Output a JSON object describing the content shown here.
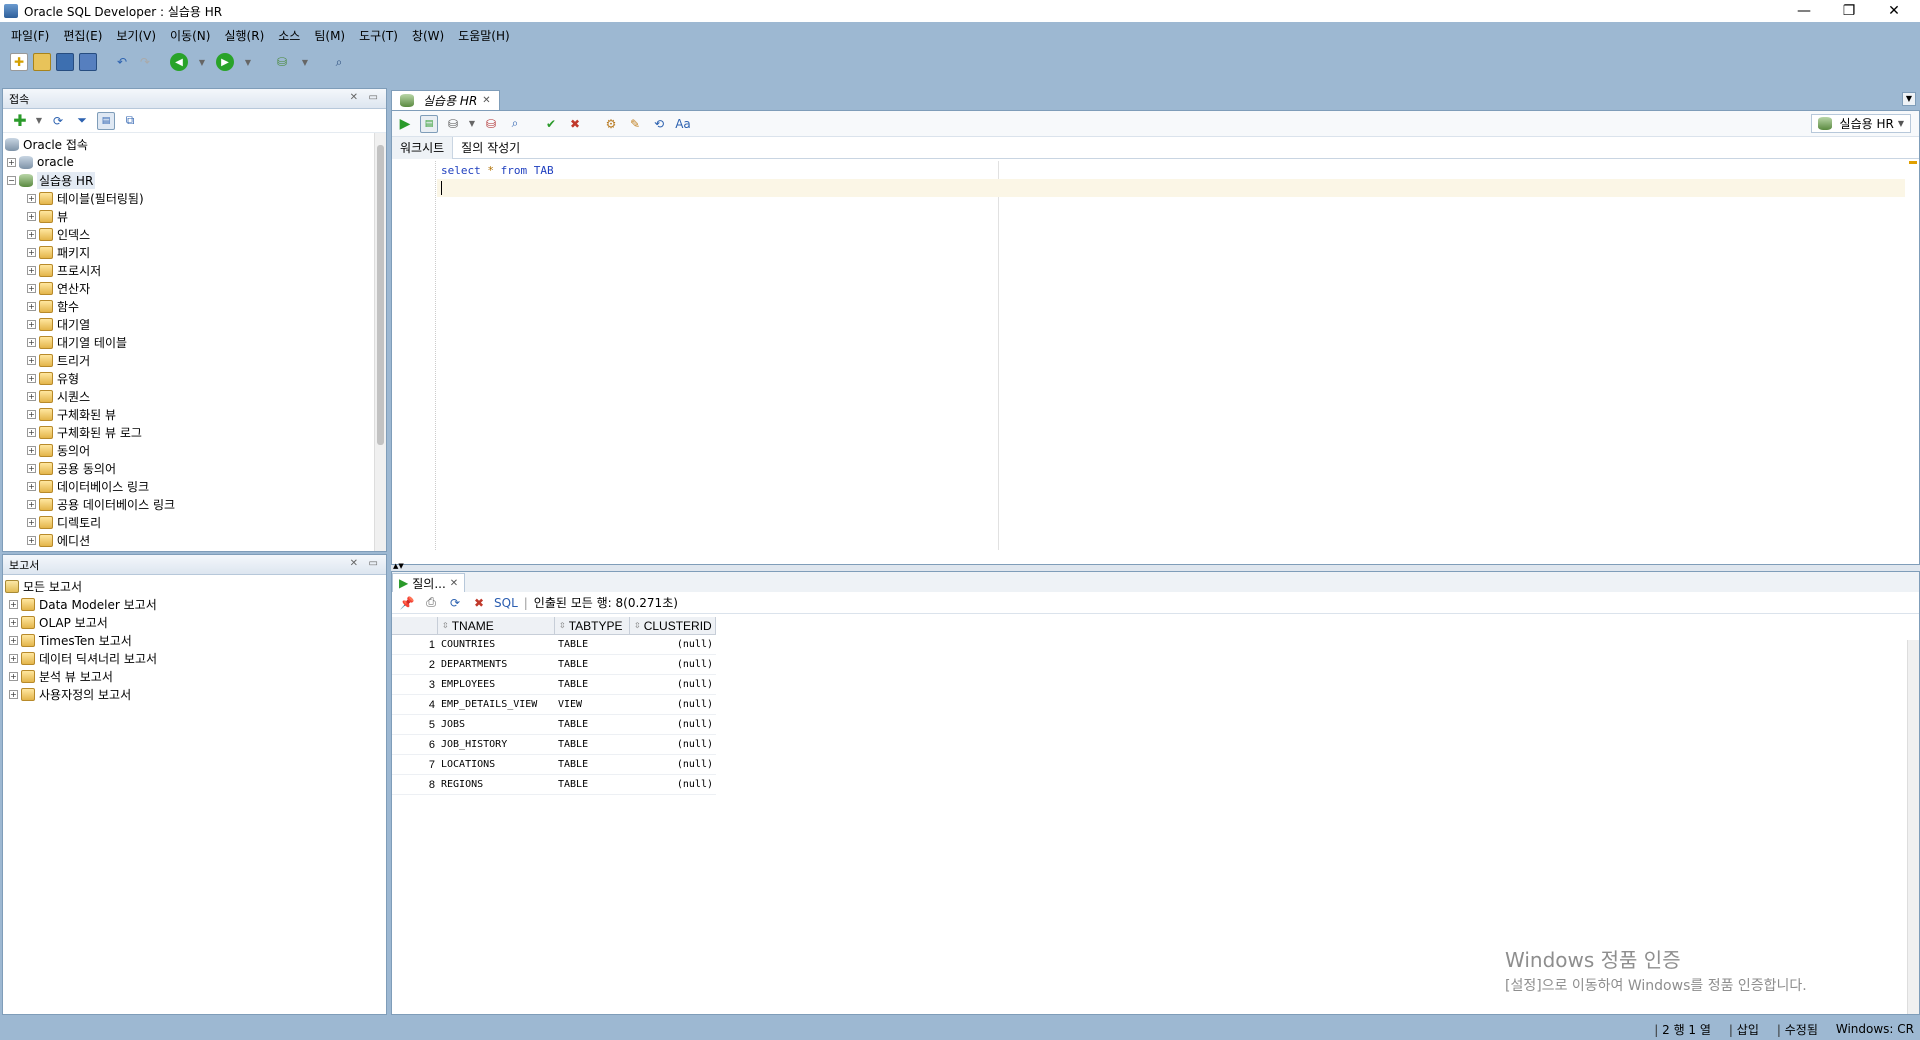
{
  "window": {
    "title": "Oracle SQL Developer : 실습용 HR",
    "controls": {
      "minimize": "—",
      "restore": "❐",
      "close": "✕"
    }
  },
  "menu": [
    "파일(F)",
    "편집(E)",
    "보기(V)",
    "이동(N)",
    "실행(R)",
    "소스",
    "팀(M)",
    "도구(T)",
    "창(W)",
    "도움말(H)"
  ],
  "connections_panel": {
    "title": "접속",
    "tree": {
      "root": "Oracle 접속",
      "conn_oracle": "oracle",
      "conn_hr": "실습용 HR",
      "children": [
        "테이블(필터링됨)",
        "뷰",
        "인덱스",
        "패키지",
        "프로시저",
        "연산자",
        "함수",
        "대기열",
        "대기열 테이블",
        "트리거",
        "유형",
        "시퀀스",
        "구체화된 뷰",
        "구체화된 뷰 로그",
        "동의어",
        "공용 동의어",
        "데이터베이스 링크",
        "공용 데이터베이스 링크",
        "디렉토리",
        "에디션"
      ]
    }
  },
  "reports_panel": {
    "title": "보고서",
    "root": "모든 보고서",
    "items": [
      "Data Modeler 보고서",
      "OLAP 보고서",
      "TimesTen 보고서",
      "데이터 딕셔너리 보고서",
      "분석 뷰 보고서",
      "사용자정의 보고서"
    ]
  },
  "editor": {
    "tab_label": "실습용 HR",
    "subtabs": [
      "워크시트",
      "질의 작성기"
    ],
    "connection_select": "실습용 HR",
    "code": {
      "kw1": "select",
      "star": "*",
      "kw2": "from",
      "table": "TAB"
    }
  },
  "result": {
    "tab_label": "질의...",
    "sql_link": "SQL",
    "status": "인출된 모든 행: 8(0.271초)",
    "columns": [
      "TNAME",
      "TABTYPE",
      "CLUSTERID"
    ],
    "rows": [
      {
        "n": "1",
        "tname": "COUNTRIES",
        "tabtype": "TABLE",
        "clusterid": "(null)"
      },
      {
        "n": "2",
        "tname": "DEPARTMENTS",
        "tabtype": "TABLE",
        "clusterid": "(null)"
      },
      {
        "n": "3",
        "tname": "EMPLOYEES",
        "tabtype": "TABLE",
        "clusterid": "(null)"
      },
      {
        "n": "4",
        "tname": "EMP_DETAILS_VIEW",
        "tabtype": "VIEW",
        "clusterid": "(null)"
      },
      {
        "n": "5",
        "tname": "JOBS",
        "tabtype": "TABLE",
        "clusterid": "(null)"
      },
      {
        "n": "6",
        "tname": "JOB_HISTORY",
        "tabtype": "TABLE",
        "clusterid": "(null)"
      },
      {
        "n": "7",
        "tname": "LOCATIONS",
        "tabtype": "TABLE",
        "clusterid": "(null)"
      },
      {
        "n": "8",
        "tname": "REGIONS",
        "tabtype": "TABLE",
        "clusterid": "(null)"
      }
    ]
  },
  "watermark": {
    "line1": "Windows 정품 인증",
    "line2": "[설정]으로 이동하여 Windows를 정품 인증합니다."
  },
  "statusbar": {
    "position": "2 행 1 열",
    "mode": "삽입",
    "state": "수정됨",
    "os": "Windows: CR"
  },
  "colors": {
    "frame": "#9db8d2",
    "border": "#7f9db9",
    "keyword": "#1f3fbf",
    "run_green": "#29a329"
  }
}
